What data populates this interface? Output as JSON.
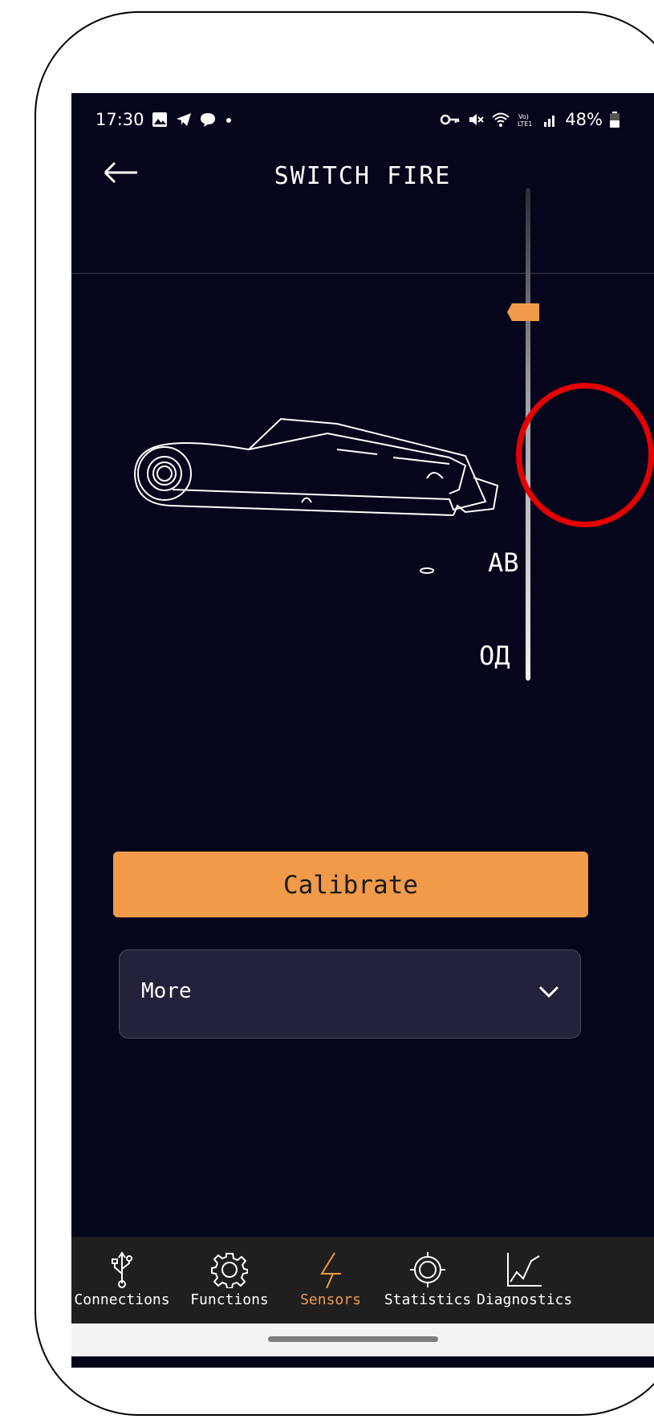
{
  "status_bar": {
    "time": "17:30",
    "battery": "48%",
    "icons": [
      "gallery-icon",
      "telegram-icon",
      "chat-icon",
      "dot-icon",
      "key-icon",
      "mute-icon",
      "wifi-icon",
      "volte-icon",
      "signal-icon",
      "battery-icon"
    ]
  },
  "header": {
    "title": "SWITCH FIRE",
    "back_icon": "back-arrow-icon"
  },
  "sensor": {
    "position_labels": [
      "AB",
      "ОД"
    ]
  },
  "actions": {
    "calibrate_label": "Calibrate",
    "more_label": "More",
    "more_icon": "chevron-down-icon"
  },
  "tabs": [
    {
      "label": "Connections",
      "icon": "usb-icon",
      "active": false
    },
    {
      "label": "Functions",
      "icon": "gear-icon",
      "active": false
    },
    {
      "label": "Sensors",
      "icon": "bolt-icon",
      "active": true
    },
    {
      "label": "Statistics",
      "icon": "target-icon",
      "active": false
    },
    {
      "label": "Diagnostics",
      "icon": "chart-icon",
      "active": false
    }
  ],
  "colors": {
    "background": "#05061c",
    "accent": "#f09a4a",
    "highlight_ring": "#e60000"
  }
}
